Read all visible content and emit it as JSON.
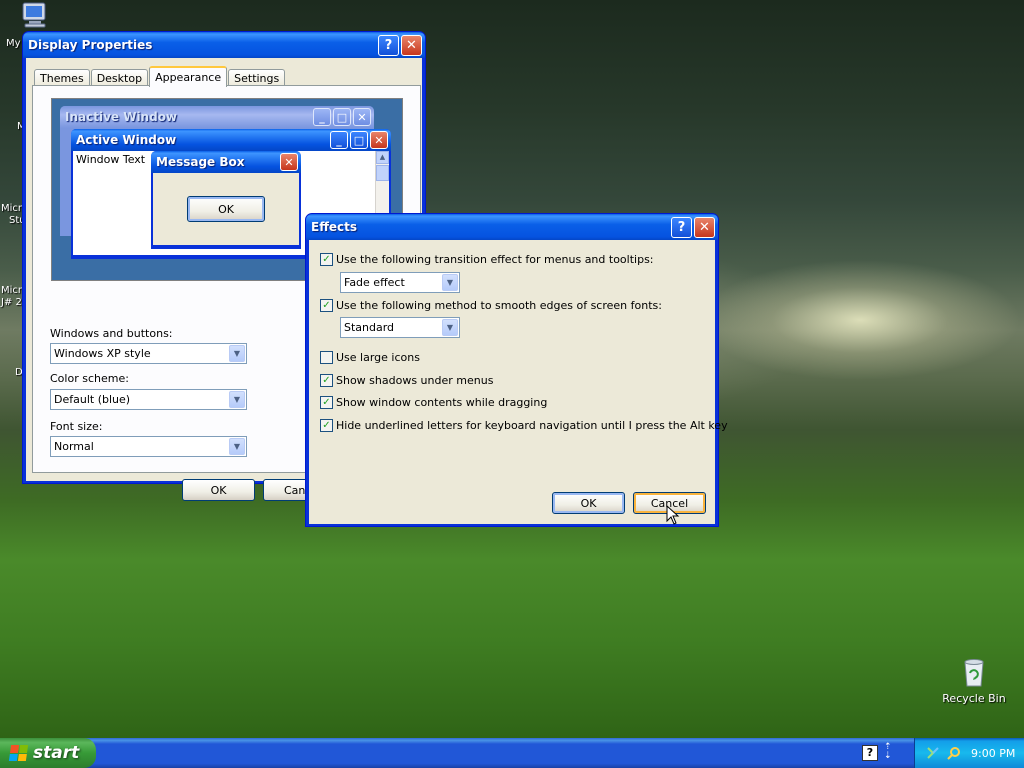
{
  "desktop": {
    "icons": {
      "my_computer_frag": "My",
      "recycle_bin": "Recycle Bin"
    },
    "fragments": [
      "M",
      "Micro",
      "Stu",
      "Micro",
      "J# 2",
      "D"
    ]
  },
  "display_properties": {
    "title": "Display Properties",
    "tabs": [
      "Themes",
      "Desktop",
      "Appearance",
      "Settings"
    ],
    "active_tab": "Appearance",
    "preview": {
      "inactive_title": "Inactive Window",
      "active_title": "Active Window",
      "window_text": "Window Text",
      "message_box_title": "Message Box",
      "message_box_ok": "OK"
    },
    "windows_buttons_label": "Windows and buttons:",
    "windows_buttons_value": "Windows XP style",
    "color_scheme_label": "Color scheme:",
    "color_scheme_value": "Default (blue)",
    "font_size_label": "Font size:",
    "font_size_value": "Normal",
    "ok_label": "OK",
    "cancel_label_partial": "Canc"
  },
  "effects": {
    "title": "Effects",
    "options": [
      {
        "label": "Use the following transition effect for menus and tooltips:",
        "checked": true
      },
      {
        "label": "Use the following method to smooth edges of screen fonts:",
        "checked": true
      },
      {
        "label": "Use large icons",
        "checked": false
      },
      {
        "label": "Show shadows under menus",
        "checked": true
      },
      {
        "label": "Show window contents while dragging",
        "checked": true
      },
      {
        "label": "Hide underlined letters for keyboard navigation until I press the Alt key",
        "checked": true
      }
    ],
    "transition_value": "Fade effect",
    "smoothing_value": "Standard",
    "ok_label": "OK",
    "cancel_label": "Cancel"
  },
  "taskbar": {
    "start_label": "start",
    "clock": "9:00 PM"
  },
  "colors": {
    "xp_blue": "#0831d9",
    "dialog_bg": "#ece9d8",
    "start_green": "#379a37",
    "check_green": "#21a121"
  }
}
